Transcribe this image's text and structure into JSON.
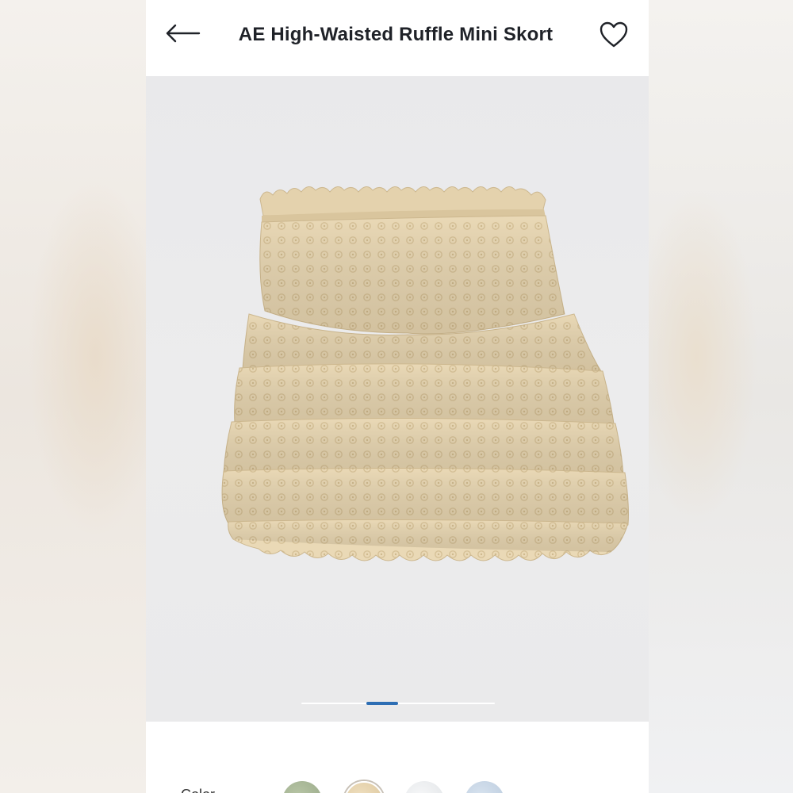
{
  "header": {
    "title": "AE High-Waisted Ruffle Mini Skort"
  },
  "icons": {
    "back": "arrow-left-icon",
    "favorite": "heart-outline-icon"
  },
  "gallery": {
    "image_count": 3,
    "active_index": 2,
    "product": "ruffle mini skort, cream eyelet lace"
  },
  "color_selector": {
    "label": "Color",
    "swatches": [
      {
        "name": "sage",
        "color": "#a9b898"
      },
      {
        "name": "cream",
        "color": "#e6d3ae",
        "selected": true
      },
      {
        "name": "white",
        "color": "#eef0f1"
      },
      {
        "name": "light-blue",
        "color": "#c9d7e6"
      }
    ]
  },
  "colors": {
    "accent": "#2d6eb4",
    "title": "#1f2228",
    "fabric": "#e9d7b2"
  }
}
